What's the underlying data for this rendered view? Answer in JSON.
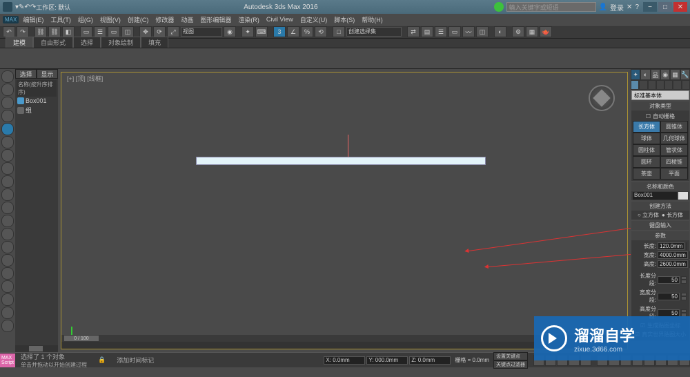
{
  "titlebar": {
    "workspace": "工作区: 默认",
    "title": "Autodesk 3ds Max 2016",
    "search_placeholder": "输入关键字或短语",
    "login": "登录"
  },
  "menu": [
    "编辑(E)",
    "工具(T)",
    "组(G)",
    "视图(V)",
    "创建(C)",
    "修改器",
    "动画",
    "图形编辑器",
    "渲染(R)",
    "Civil View",
    "自定义(U)",
    "脚本(S)",
    "帮助(H)"
  ],
  "tabs": {
    "items": [
      "建模",
      "自由形式",
      "选择",
      "对象绘制",
      "填充"
    ],
    "active": 0
  },
  "explorer": {
    "selTab": "选择",
    "dispTab": "显示",
    "header": "名称(按升序排序)",
    "items": [
      {
        "name": "Box001"
      },
      {
        "name": "组"
      }
    ]
  },
  "viewport": {
    "label": "[+] [顶] [线框]",
    "slider": "0 / 100"
  },
  "panel": {
    "geom_dd": "标准基本体",
    "obj_type": {
      "title": "对象类型",
      "autogrid": "自动栅格",
      "btns": [
        "长方体",
        "圆锥体",
        "球体",
        "几何球体",
        "圆柱体",
        "管状体",
        "圆环",
        "四棱锥",
        "茶壶",
        "平面"
      ],
      "active": 0
    },
    "name_color": {
      "title": "名称和颜色",
      "name": "Box001"
    },
    "method": {
      "title": "创建方法",
      "opt1": "立方体",
      "opt2": "长方体"
    },
    "kbd": {
      "title": "键盘输入"
    },
    "params": {
      "title": "参数",
      "length_l": "长度:",
      "length_v": "120.0mm",
      "width_l": "宽度:",
      "width_v": "4000.0mm",
      "height_l": "高度:",
      "height_v": "2600.0mm",
      "lseg_l": "长度分段:",
      "lseg_v": "50",
      "wseg_l": "宽度分段:",
      "wseg_v": "50",
      "hseg_l": "高度分段:",
      "hseg_v": "50",
      "genmap": "生成贴图坐标",
      "realworld": "真实世界贴图大小"
    }
  },
  "status": {
    "sel": "选择了 1 个对象",
    "hint": "单击并拖动以开始创建过程",
    "addtime": "添加时间标记",
    "setkey": "设置关键点",
    "keyfilter": "关键点过滤器",
    "x": "X: 0.0mm",
    "y": "Y: 000.0mm",
    "z": "Z: 0.0mm",
    "grid": "栅格 = 0.0mm"
  },
  "watermark": {
    "brand": "溜溜自学",
    "url": "zixue.3d66.com"
  }
}
